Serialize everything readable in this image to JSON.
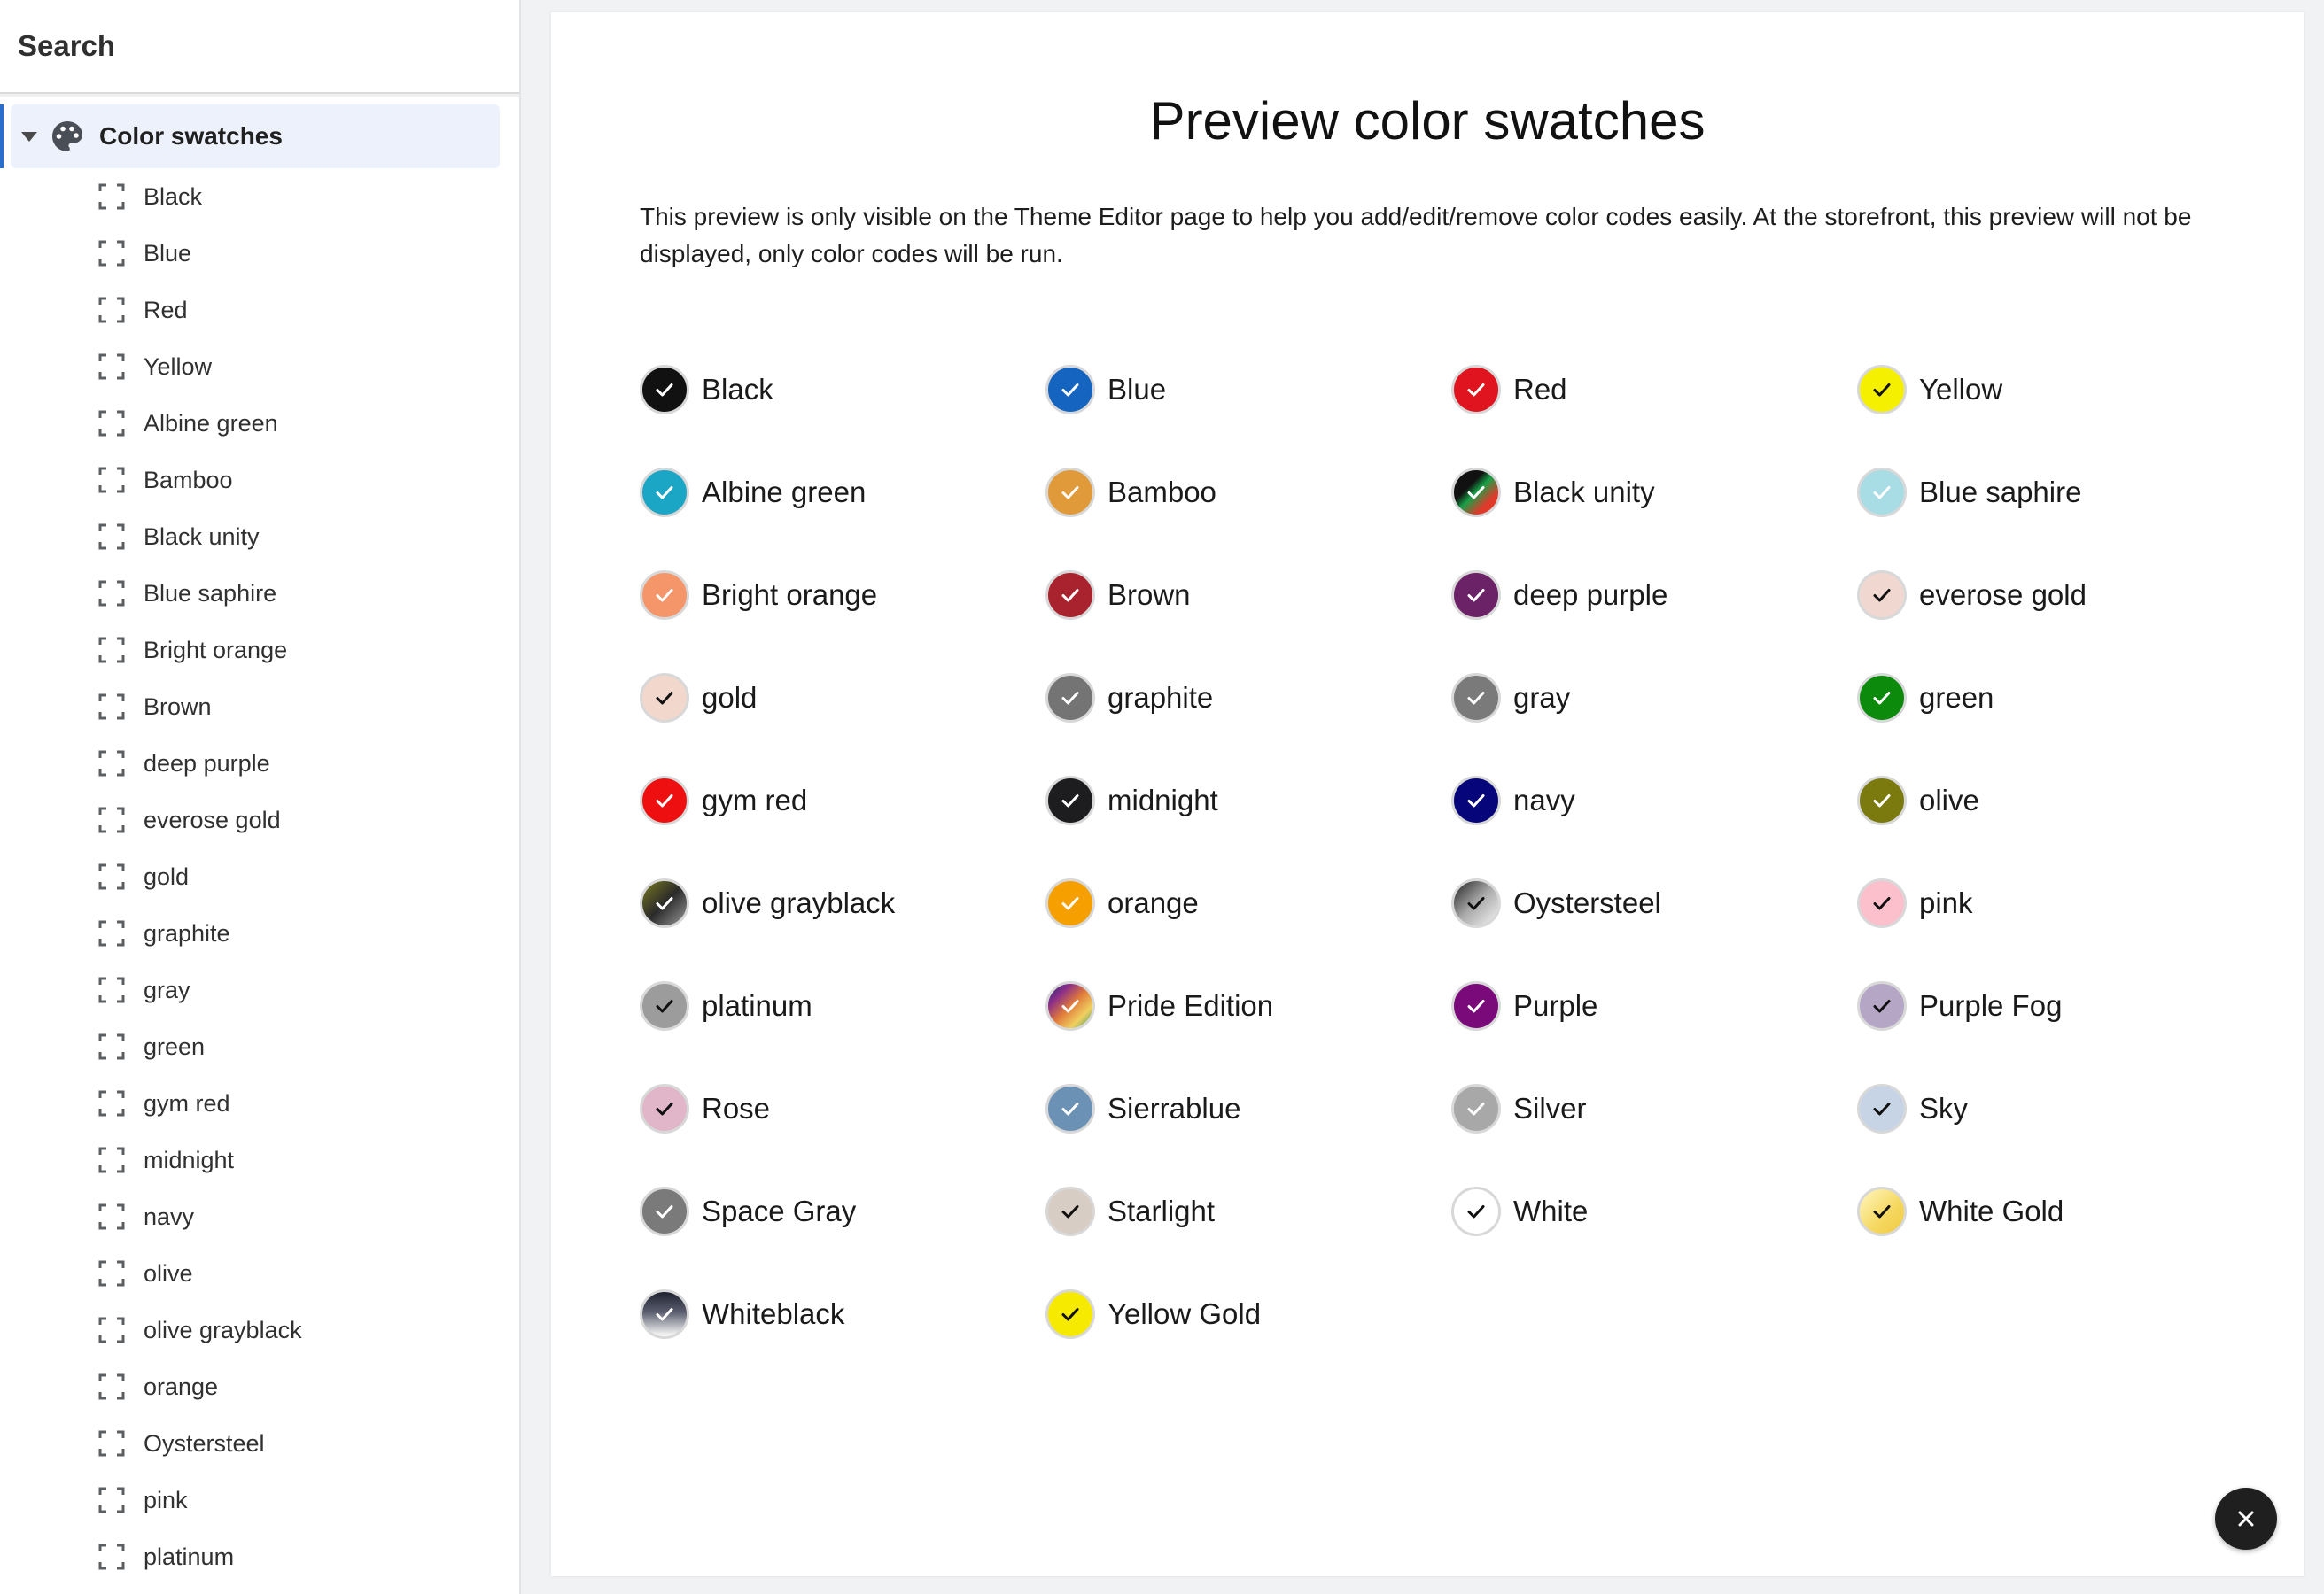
{
  "sidebar": {
    "search_label": "Search",
    "parent": {
      "label": "Color swatches",
      "icon": "palette-icon"
    },
    "items": [
      "Black",
      "Blue",
      "Red",
      "Yellow",
      "Albine green",
      "Bamboo",
      "Black unity",
      "Blue saphire",
      "Bright orange",
      "Brown",
      "deep purple",
      "everose gold",
      "gold",
      "graphite",
      "gray",
      "green",
      "gym red",
      "midnight",
      "navy",
      "olive",
      "olive grayblack",
      "orange",
      "Oystersteel",
      "pink",
      "platinum"
    ]
  },
  "main": {
    "title": "Preview color swatches",
    "description": "This preview is only visible on the Theme Editor page to help you add/edit/remove color codes easily. At the storefront, this preview will not be displayed, only color codes will be run."
  },
  "swatches": [
    {
      "label": "Black",
      "bg": "#111111",
      "check": "#ffffff"
    },
    {
      "label": "Blue",
      "bg": "#1565c0",
      "check": "#ffffff"
    },
    {
      "label": "Red",
      "bg": "#e0141e",
      "check": "#ffffff"
    },
    {
      "label": "Yellow",
      "bg": "#f5f000",
      "check": "#111111"
    },
    {
      "label": "Albine green",
      "bg": "#1aa6c4",
      "check": "#ffffff"
    },
    {
      "label": "Bamboo",
      "bg": "#e09a3a",
      "check": "#ffffff"
    },
    {
      "label": "Black unity",
      "bg": "linear-gradient(135deg,#111 0%,#111 35%,#18a048 50%,#e03a2a 75%,#e03a2a 100%)",
      "check": "#ffffff"
    },
    {
      "label": "Blue saphire",
      "bg": "#a9dde6",
      "check": "#ffffff"
    },
    {
      "label": "Bright orange",
      "bg": "#f4966a",
      "check": "#ffffff"
    },
    {
      "label": "Brown",
      "bg": "#a8232e",
      "check": "#ffffff"
    },
    {
      "label": "deep purple",
      "bg": "#6b2266",
      "check": "#ffffff"
    },
    {
      "label": "everose gold",
      "bg": "#f0d8d0",
      "check": "#111111"
    },
    {
      "label": "gold",
      "bg": "#f2d7cc",
      "check": "#111111"
    },
    {
      "label": "graphite",
      "bg": "#747474",
      "check": "#ffffff"
    },
    {
      "label": "gray",
      "bg": "#7a7a7a",
      "check": "#ffffff"
    },
    {
      "label": "green",
      "bg": "#0c8a0c",
      "check": "#ffffff"
    },
    {
      "label": "gym red",
      "bg": "#ee1010",
      "check": "#ffffff"
    },
    {
      "label": "midnight",
      "bg": "#1d1d1f",
      "check": "#ffffff"
    },
    {
      "label": "navy",
      "bg": "#06067a",
      "check": "#ffffff"
    },
    {
      "label": "olive",
      "bg": "#7b7a0e",
      "check": "#ffffff"
    },
    {
      "label": "olive grayblack",
      "bg": "linear-gradient(135deg,#7a7a20 0%,#2a2a2a 50%,#9a9a9a 100%)",
      "check": "#ffffff"
    },
    {
      "label": "orange",
      "bg": "#f5a000",
      "check": "#ffffff"
    },
    {
      "label": "Oystersteel",
      "bg": "linear-gradient(135deg,#222 0%,#aaa 50%,#f4f4f4 100%)",
      "check": "#111111"
    },
    {
      "label": "pink",
      "bg": "#fbc0cc",
      "check": "#111111"
    },
    {
      "label": "platinum",
      "bg": "#9c9c9c",
      "check": "#111111"
    },
    {
      "label": "Pride Edition",
      "bg": "linear-gradient(135deg,#1b2a6e 0%,#8a2e8a 25%,#e07a3a 50%,#f0d060 75%,#3a9a6a 100%)",
      "check": "#ffffff"
    },
    {
      "label": "Purple",
      "bg": "#7a0a7a",
      "check": "#ffffff"
    },
    {
      "label": "Purple Fog",
      "bg": "#b6a6c6",
      "check": "#111111"
    },
    {
      "label": "Rose",
      "bg": "#e0b6c8",
      "check": "#111111"
    },
    {
      "label": "Sierrablue",
      "bg": "#6b92b4",
      "check": "#ffffff"
    },
    {
      "label": "Silver",
      "bg": "#a8a8a8",
      "check": "#ffffff"
    },
    {
      "label": "Sky",
      "bg": "#c6d4e6",
      "check": "#111111"
    },
    {
      "label": "Space Gray",
      "bg": "#7a7a7a",
      "check": "#ffffff"
    },
    {
      "label": "Starlight",
      "bg": "#d8cdc4",
      "check": "#111111"
    },
    {
      "label": "White",
      "bg": "#ffffff",
      "check": "#111111"
    },
    {
      "label": "White Gold",
      "bg": "linear-gradient(135deg,#fff6c0 0%,#f5d860 60%,#f0c840 100%)",
      "check": "#111111"
    },
    {
      "label": "Whiteblack",
      "bg": "linear-gradient(180deg,#1e2230 0%,#5a5e6e 45%,#ffffff 100%)",
      "check": "#ffffff"
    },
    {
      "label": "Yellow Gold",
      "bg": "#f5ea00",
      "check": "#111111"
    }
  ],
  "close_button": {
    "icon": "close-icon"
  }
}
